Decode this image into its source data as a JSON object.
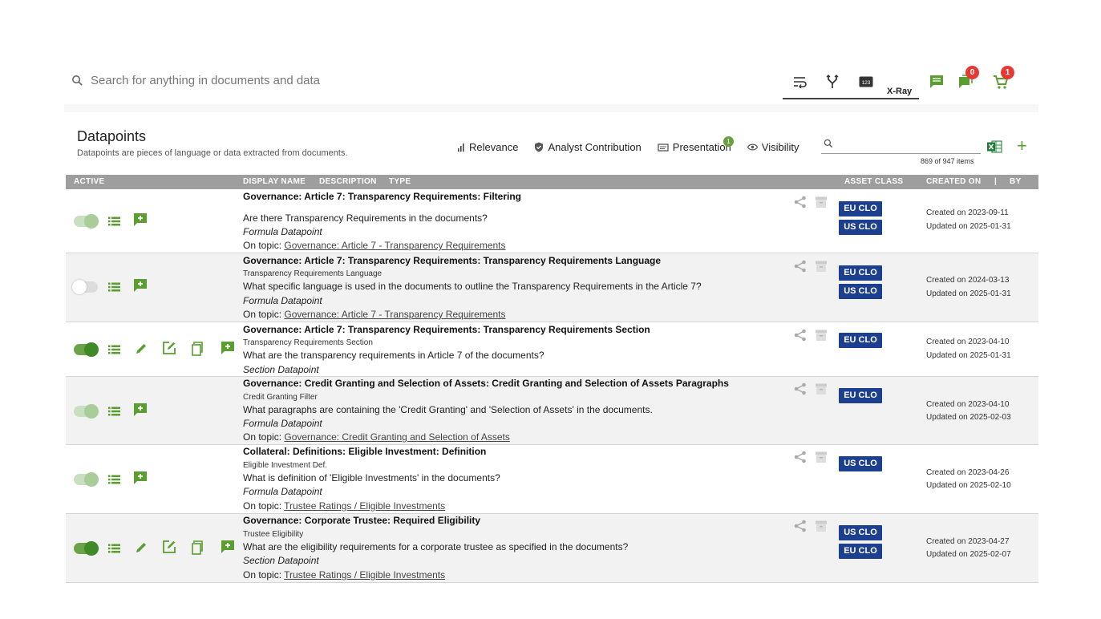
{
  "search": {
    "placeholder": "Search for anything in documents and data"
  },
  "toolbar": {
    "xray_label": "X-Ray",
    "messages_count": "0",
    "cart_count": "1"
  },
  "panel": {
    "title": "Datapoints",
    "subtitle": "Datapoints are pieces of language or data extracted from documents.",
    "filters": {
      "relevance": "Relevance",
      "analyst": "Analyst Contribution",
      "presentation": "Presentation",
      "presentation_badge": "1",
      "visibility": "Visibility"
    },
    "item_count": "869 of 947 items"
  },
  "table": {
    "headers": {
      "active": "ACTIVE",
      "display_name": "DISPLAY NAME",
      "description": "DESCRIPTION",
      "type": "TYPE",
      "asset_class": "ASSET CLASS",
      "created_on": "CREATED ON",
      "sep": "|",
      "by": "BY"
    },
    "topic_prefix": "On topic:",
    "rows": [
      {
        "title": "Governance: Article 7: Transparency Requirements: Filtering",
        "description": "",
        "question": "Are there Transparency Requirements in the documents?",
        "type": "Formula Datapoint",
        "topic": "Governance: Article 7 - Transparency Requirements",
        "assets": [
          "EU CLO",
          "US CLO"
        ],
        "created": "Created on 2023-09-11",
        "updated": "Updated on 2025-01-31"
      },
      {
        "title": "Governance: Article 7: Transparency Requirements: Transparency Requirements Language",
        "description": "Transparency Requirements Language",
        "question": "What specific language is used in the documents to outline the Transparency Requirements in the Article 7?",
        "type": "Formula Datapoint",
        "topic": "Governance: Article 7 - Transparency Requirements",
        "assets": [
          "EU CLO",
          "US CLO"
        ],
        "created": "Created on 2024-03-13",
        "updated": "Updated on 2025-01-31"
      },
      {
        "title": "Governance: Article 7: Transparency Requirements: Transparency Requirements Section",
        "description": "Transparency Requirements Section",
        "question": "What are the transparency requirements in Article 7 of the documents?",
        "type": "Section Datapoint",
        "topic": "",
        "assets": [
          "EU CLO"
        ],
        "created": "Created on 2023-04-10",
        "updated": "Updated on 2025-01-31"
      },
      {
        "title": "Governance: Credit Granting and Selection of Assets: Credit Granting and Selection of Assets Paragraphs",
        "description": "Credit Granting Filter",
        "question": "What paragraphs are containing the 'Credit Granting' and 'Selection of Assets' in the documents.",
        "type": "Formula Datapoint",
        "topic": "Governance: Credit Granting and Selection of Assets",
        "assets": [
          "EU CLO"
        ],
        "created": "Created on 2023-04-10",
        "updated": "Updated on 2025-02-03"
      },
      {
        "title": "Collateral: Definitions: Eligible Investment: Definition",
        "description": "Eligible Investment Def.",
        "question": "What is definition of 'Eligible Investments' in the documents?",
        "type": "Formula Datapoint",
        "topic": "Trustee Ratings / Eligible Investments",
        "assets": [
          "US CLO"
        ],
        "created": "Created on 2023-04-26",
        "updated": "Updated on 2025-02-10"
      },
      {
        "title": "Governance: Corporate Trustee: Required Eligibility",
        "description": "Trustee Eligibility",
        "question": "What are the eligibility requirements for a corporate trustee as specified in the documents?",
        "type": "Section Datapoint",
        "topic": "Trustee Ratings / Eligible Investments",
        "assets": [
          "US CLO",
          "EU CLO"
        ],
        "created": "Created on 2023-04-27",
        "updated": "Updated on 2025-02-07"
      }
    ]
  },
  "colors": {
    "accent_green": "#5a9e2f",
    "asset_blue": "#1d3f8f",
    "badge_red": "#e53935",
    "header_gray": "#9e9e9e"
  },
  "icons": [
    "search-icon",
    "wrap-text-icon",
    "merge-icon",
    "numbers-icon",
    "comment-icon",
    "chat-icon",
    "cart-icon",
    "relevance-icon",
    "shield-icon",
    "presentation-icon",
    "eye-icon",
    "excel-icon",
    "plus-icon",
    "list-icon",
    "add-comment-icon",
    "pencil-icon",
    "edit-box-icon",
    "copy-icon",
    "share-icon",
    "archive-icon"
  ]
}
